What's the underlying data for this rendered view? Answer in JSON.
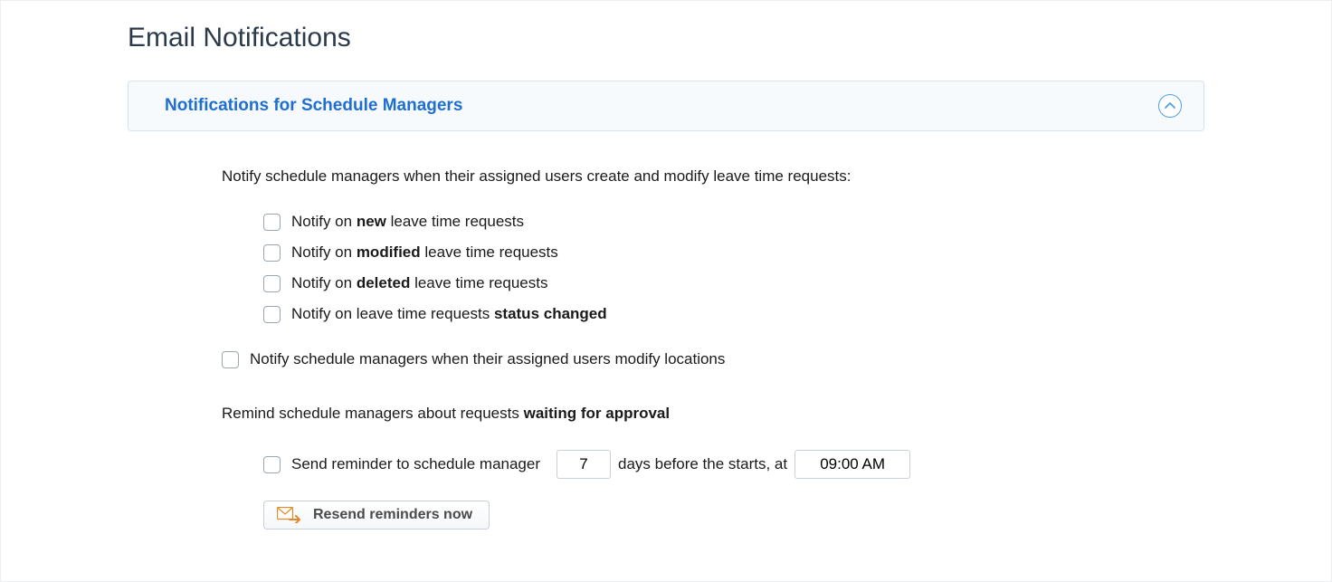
{
  "page": {
    "title": "Email Notifications"
  },
  "accordion": {
    "title": "Notifications for Schedule Managers"
  },
  "section1": {
    "intro": "Notify schedule managers when their assigned users create and modify leave time requests:",
    "items": [
      {
        "pre": "Notify on ",
        "strong": "new",
        "post": " leave time requests"
      },
      {
        "pre": "Notify on ",
        "strong": "modified",
        "post": " leave time requests"
      },
      {
        "pre": "Notify on ",
        "strong": "deleted",
        "post": " leave time requests"
      },
      {
        "pre": "Notify on leave time requests ",
        "strong": "status changed",
        "post": ""
      }
    ]
  },
  "section2": {
    "label": "Notify schedule managers when their assigned users modify locations"
  },
  "section3": {
    "intro_pre": "Remind schedule managers about requests ",
    "intro_strong": "waiting for approval",
    "row": {
      "label_before": "Send reminder to schedule manager",
      "days_value": "7",
      "label_mid": "days before the starts, at",
      "time_value": "09:00 AM"
    },
    "resend_label": "Resend reminders now"
  }
}
